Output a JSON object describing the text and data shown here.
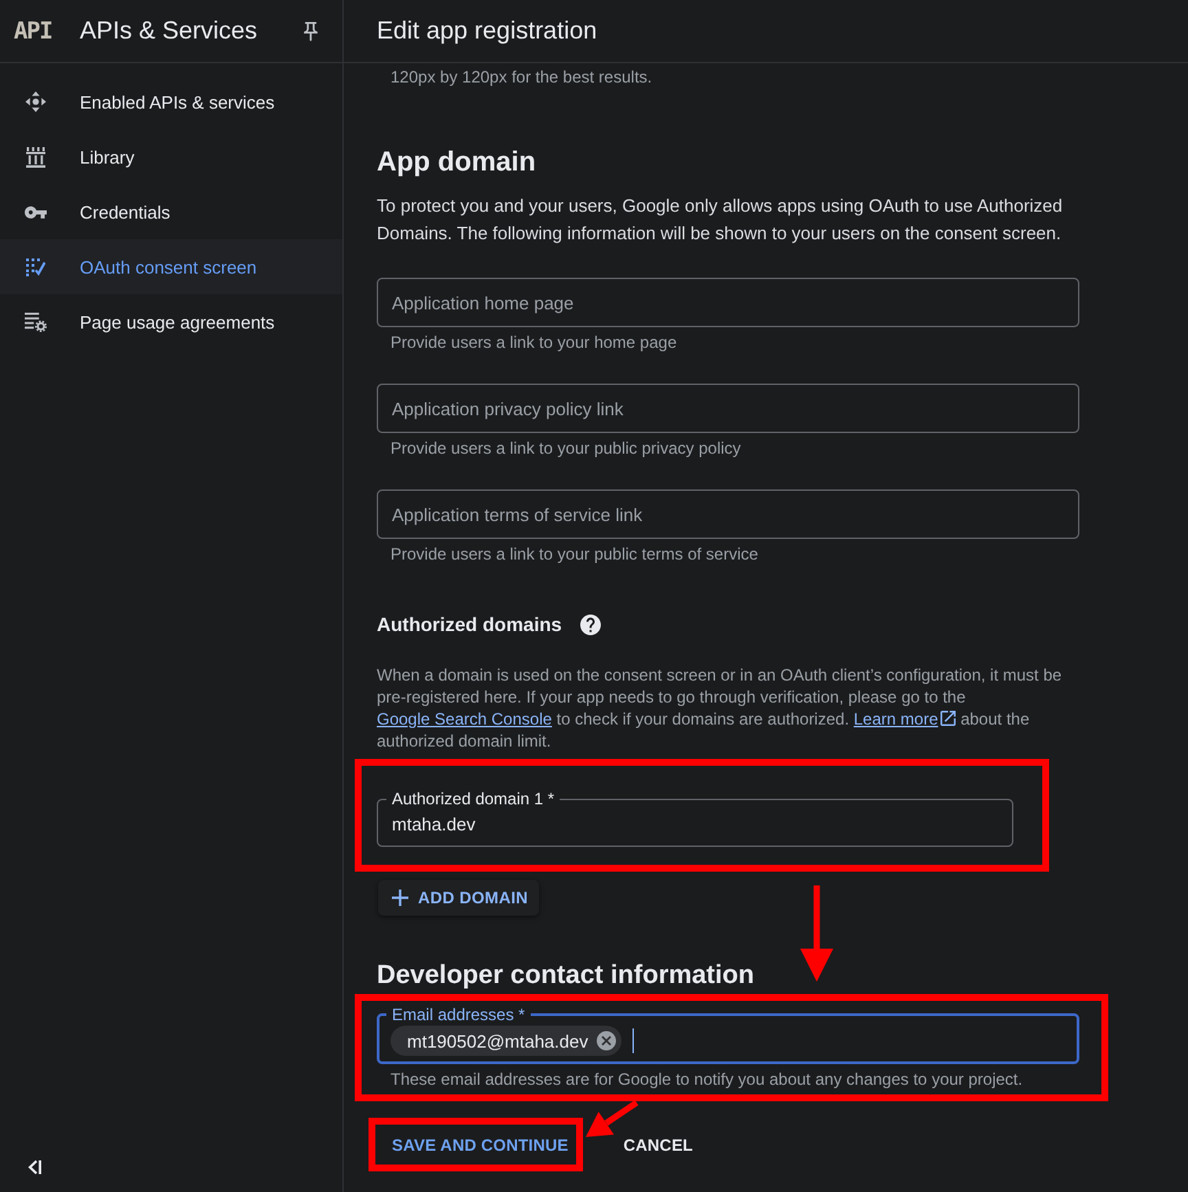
{
  "sidebar": {
    "logo": "API",
    "title": "APIs & Services",
    "items": [
      {
        "label": "Enabled APIs & services",
        "selected": false
      },
      {
        "label": "Library",
        "selected": false
      },
      {
        "label": "Credentials",
        "selected": false
      },
      {
        "label": "OAuth consent screen",
        "selected": true
      },
      {
        "label": "Page usage agreements",
        "selected": false
      }
    ]
  },
  "header": {
    "title": "Edit app registration"
  },
  "form": {
    "scrolled_text": "120px by 120px for the best results.",
    "app_domain": {
      "heading": "App domain",
      "description": "To protect you and your users, Google only allows apps using OAuth to use Authorized Domains. The following information will be shown to your users on the consent screen.",
      "fields": [
        {
          "placeholder": "Application home page",
          "hint": "Provide users a link to your home page"
        },
        {
          "placeholder": "Application privacy policy link",
          "hint": "Provide users a link to your public privacy policy"
        },
        {
          "placeholder": "Application terms of service link",
          "hint": "Provide users a link to your public terms of service"
        }
      ]
    },
    "authorized_domains": {
      "heading": "Authorized domains",
      "description": [
        {
          "kind": "text",
          "text": "When a domain is used on the consent screen or in an OAuth client’s configuration, it must be pre-registered here. If your app needs to go through verification, please go to the "
        },
        {
          "kind": "link",
          "text": "Google Search Console"
        },
        {
          "kind": "text",
          "text": " to check if your domains are authorized. "
        },
        {
          "kind": "external_link",
          "text": "Learn more"
        },
        {
          "kind": "text",
          "text": " about the authorized domain limit."
        }
      ],
      "domains": [
        {
          "label": "Authorized domain 1 *",
          "value": "mtaha.dev",
          "focused": false,
          "highlighted": true
        }
      ],
      "add_button": "ADD DOMAIN"
    },
    "developer_contact": {
      "heading": "Developer contact information",
      "field": {
        "label": "Email addresses *",
        "focused": true,
        "highlighted": true,
        "chips": [
          "mt190502@mtaha.dev"
        ],
        "hint": "These email addresses are for Google to notify you about any changes to your project."
      }
    },
    "actions": [
      {
        "label": "SAVE AND CONTINUE",
        "kind": "primary",
        "highlighted": true
      },
      {
        "label": "CANCEL",
        "kind": "secondary",
        "highlighted": false
      }
    ]
  },
  "annotation_arrows": [
    {
      "kind": "down"
    },
    {
      "kind": "down_left"
    }
  ]
}
